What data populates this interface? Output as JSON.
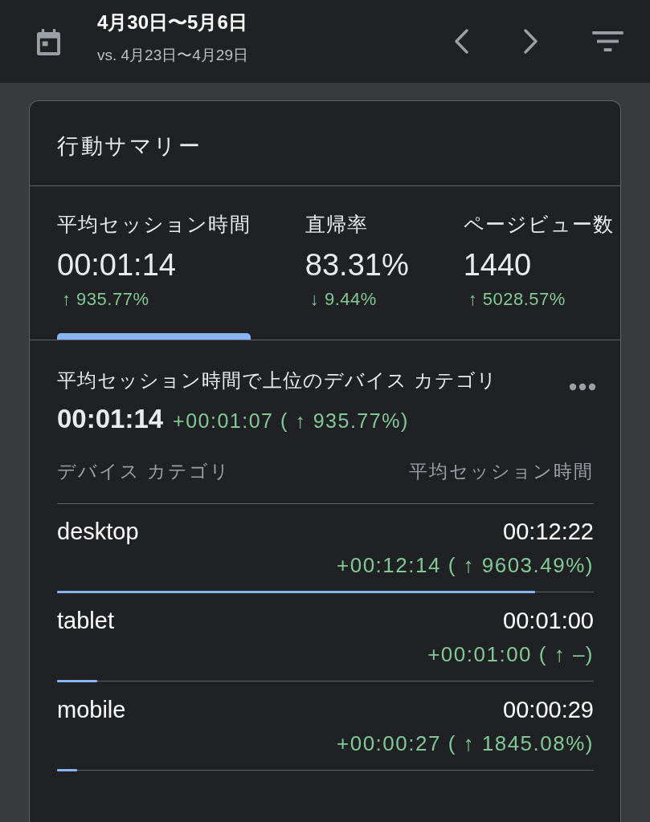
{
  "header": {
    "title": "4月30日〜5月6日",
    "subtitle": "vs. 4月23日〜4月29日"
  },
  "summary_card": {
    "title": "行動サマリー",
    "metric_tabs": [
      {
        "label": "平均セッション時間",
        "value": "00:01:14",
        "change": "↑ 935.77%",
        "selected": true
      },
      {
        "label": "直帰率",
        "value": "83.31%",
        "change": "↓ 9.44%",
        "selected": false
      },
      {
        "label": "ページビュー数",
        "value": "1440",
        "change": "↑ 5028.57%",
        "selected": false
      }
    ],
    "detail": {
      "title": "平均セッション時間で上位のデバイス カテゴリ",
      "value": "00:01:14",
      "change": "+00:01:07 ( ↑ 935.77%)"
    },
    "table": {
      "columns": [
        "デバイス カテゴリ",
        "平均セッション時間"
      ],
      "rows": [
        {
          "device": "desktop",
          "value": "00:12:22",
          "change": "+00:12:14 ( ↑ 9603.49%)",
          "level": 0.89
        },
        {
          "device": "tablet",
          "value": "00:01:00",
          "change": "+00:01:00 ( ↑ –)",
          "level": 0.075
        },
        {
          "device": "mobile",
          "value": "00:00:29",
          "change": "+00:00:27 ( ↑ 1845.08%)",
          "level": 0.037
        }
      ]
    }
  }
}
